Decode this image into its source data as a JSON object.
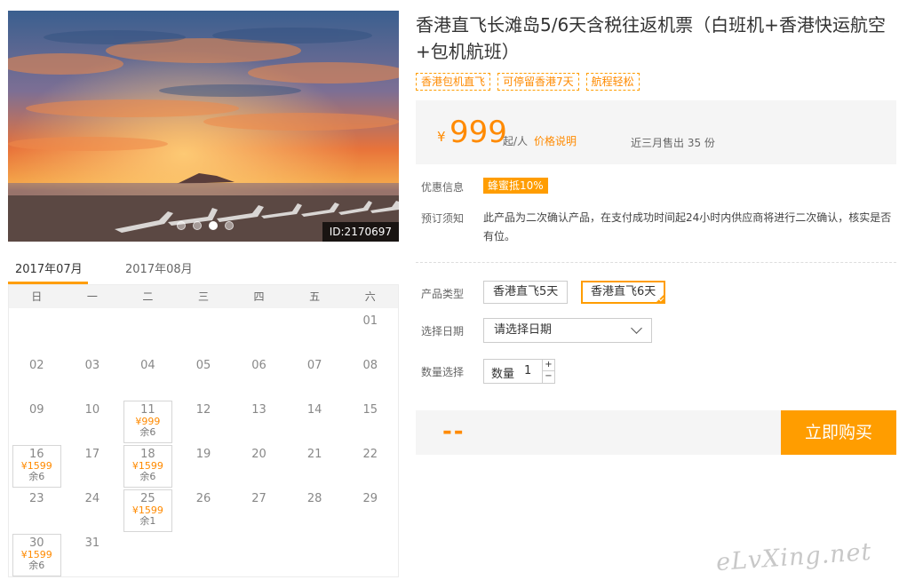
{
  "product": {
    "title": "香港直飞长滩岛5/6天含税往返机票（白班机+香港快运航空+包机航班）",
    "tags": [
      "香港包机直飞",
      "可停留香港7天",
      "航程轻松"
    ],
    "image_id": "ID:2170697",
    "carousel_active_index": 2
  },
  "price": {
    "currency": "¥",
    "amount": "999",
    "unit": "起/人",
    "explain_link": "价格说明",
    "sold": "近三月售出 35 份"
  },
  "info": {
    "promo_label": "优惠信息",
    "promo_badge": "蜂蜜抵10%",
    "notice_label": "预订须知",
    "notice_text": "此产品为二次确认产品，在支付成功时间起24小时内供应商将进行二次确认，核实是否有位。"
  },
  "options": {
    "type_label": "产品类型",
    "types": [
      "香港直飞5天",
      "香港直飞6天"
    ],
    "selected_type_index": 1,
    "date_label": "选择日期",
    "date_placeholder": "请选择日期",
    "qty_label": "数量选择",
    "qty_inner_label": "数量",
    "qty_value": "1",
    "qty_plus": "+",
    "qty_minus": "−"
  },
  "buy": {
    "total": "--",
    "button": "立即购买"
  },
  "calendar": {
    "tabs": [
      "2017年07月",
      "2017年08月"
    ],
    "active_tab": 0,
    "weekdays": [
      "日",
      "一",
      "二",
      "三",
      "四",
      "五",
      "六"
    ],
    "days": [
      {
        "d": ""
      },
      {
        "d": ""
      },
      {
        "d": ""
      },
      {
        "d": ""
      },
      {
        "d": ""
      },
      {
        "d": ""
      },
      {
        "d": "01"
      },
      {
        "d": "02"
      },
      {
        "d": "03"
      },
      {
        "d": "04"
      },
      {
        "d": "05"
      },
      {
        "d": "06"
      },
      {
        "d": "07"
      },
      {
        "d": "08"
      },
      {
        "d": "09"
      },
      {
        "d": "10"
      },
      {
        "d": "11",
        "price": "¥999",
        "rem": "余6"
      },
      {
        "d": "12"
      },
      {
        "d": "13"
      },
      {
        "d": "14"
      },
      {
        "d": "15"
      },
      {
        "d": "16",
        "price": "¥1599",
        "rem": "余6"
      },
      {
        "d": "17"
      },
      {
        "d": "18",
        "price": "¥1599",
        "rem": "余6"
      },
      {
        "d": "19"
      },
      {
        "d": "20"
      },
      {
        "d": "21"
      },
      {
        "d": "22"
      },
      {
        "d": "23"
      },
      {
        "d": "24"
      },
      {
        "d": "25",
        "price": "¥1599",
        "rem": "余1"
      },
      {
        "d": "26"
      },
      {
        "d": "27"
      },
      {
        "d": "28"
      },
      {
        "d": "29"
      },
      {
        "d": "30",
        "price": "¥1599",
        "rem": "余6"
      },
      {
        "d": "31"
      }
    ]
  },
  "watermark": "eLvXing.net"
}
